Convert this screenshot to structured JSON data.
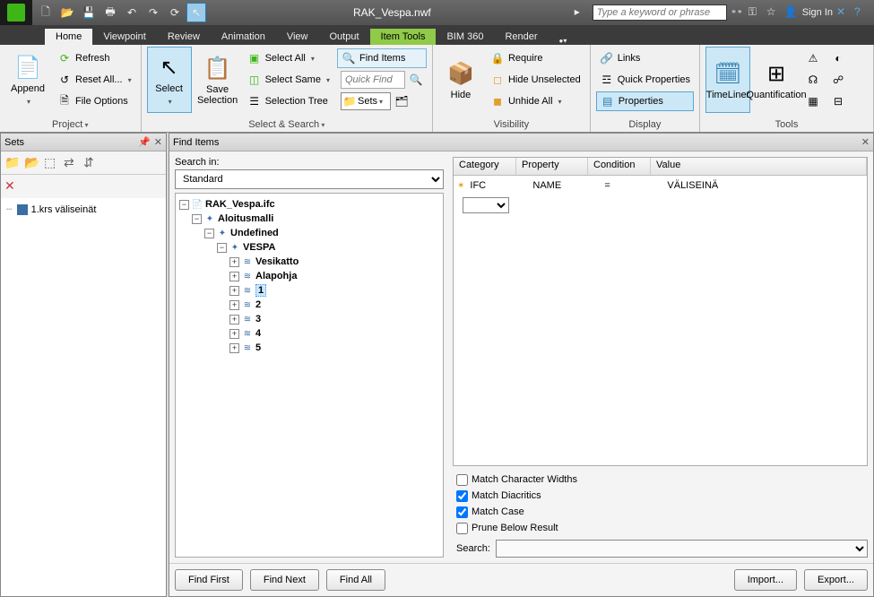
{
  "titlebar": {
    "file_title": "RAK_Vespa.nwf",
    "search_placeholder": "Type a keyword or phrase",
    "signin": "Sign In"
  },
  "tabs": {
    "home": "Home",
    "viewpoint": "Viewpoint",
    "review": "Review",
    "animation": "Animation",
    "view": "View",
    "output": "Output",
    "itemtools": "Item Tools",
    "bim360": "BIM 360",
    "render": "Render"
  },
  "ribbon": {
    "project": {
      "append": "Append",
      "refresh": "Refresh",
      "resetall": "Reset All...",
      "fileoptions": "File Options",
      "label": "Project"
    },
    "selectsearch": {
      "select": "Select",
      "savesel": "Save Selection",
      "selectall": "Select All",
      "selectsame": "Select Same",
      "seltree": "Selection Tree",
      "finditems": "Find Items",
      "quickfind_ph": "Quick Find",
      "sets": "Sets",
      "label": "Select & Search"
    },
    "visibility": {
      "hide": "Hide",
      "require": "Require",
      "hideunsel": "Hide Unselected",
      "unhideall": "Unhide All",
      "label": "Visibility"
    },
    "display": {
      "links": "Links",
      "quickprops": "Quick Properties",
      "properties": "Properties",
      "label": "Display"
    },
    "tools": {
      "timeliner": "TimeLiner",
      "quant": "Quantification",
      "label": "Tools"
    }
  },
  "sets_panel": {
    "title": "Sets",
    "item1": "1.krs väliseinät"
  },
  "find": {
    "title": "Find Items",
    "searchin_label": "Search in:",
    "searchin_value": "Standard",
    "tree": {
      "root": "RAK_Vespa.ifc",
      "n1": "Aloitusmalli",
      "n2": "Undefined",
      "n3": "VESPA",
      "n4": "Vesikatto",
      "n5": "Alapohja",
      "n6": "1",
      "n7": "2",
      "n8": "3",
      "n9": "4",
      "n10": "5"
    },
    "cols": {
      "cat": "Category",
      "prop": "Property",
      "cond": "Condition",
      "val": "Value"
    },
    "row": {
      "cat": "IFC",
      "prop": "NAME",
      "cond": "=",
      "val": "VÄLISEINÄ"
    },
    "opt1": "Match Character Widths",
    "opt2": "Match Diacritics",
    "opt3": "Match Case",
    "opt4": "Prune Below Result",
    "search_label": "Search:",
    "btn_first": "Find First",
    "btn_next": "Find Next",
    "btn_all": "Find All",
    "btn_import": "Import...",
    "btn_export": "Export..."
  }
}
